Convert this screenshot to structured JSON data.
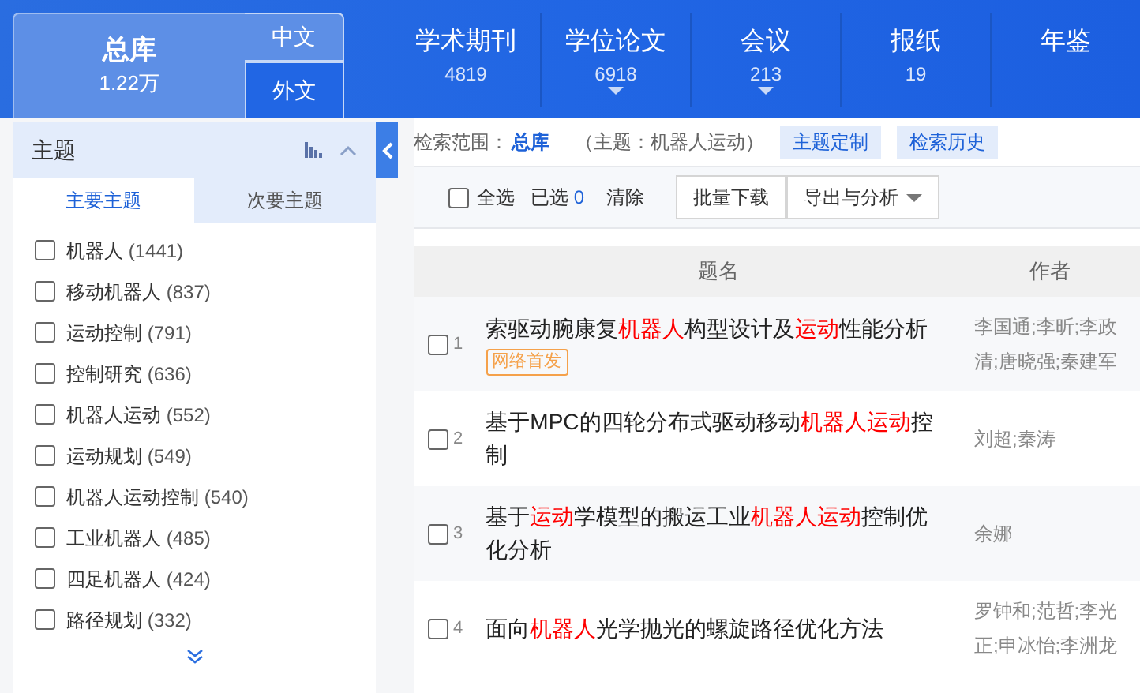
{
  "database_tabs": {
    "main": {
      "label": "总库",
      "count": "1.22万",
      "selected": true
    },
    "languages": [
      {
        "label": "中文",
        "selected": true
      },
      {
        "label": "外文",
        "selected": false
      }
    ],
    "categories": [
      {
        "label": "学术期刊",
        "count": "4819",
        "has_menu": false
      },
      {
        "label": "学位论文",
        "count": "6918",
        "has_menu": true
      },
      {
        "label": "会议",
        "count": "213",
        "has_menu": true
      },
      {
        "label": "报纸",
        "count": "19",
        "has_menu": false
      },
      {
        "label": "年鉴",
        "has_menu": false
      }
    ]
  },
  "facet_panel": {
    "title": "主题",
    "tabs": [
      {
        "label": "主要主题",
        "selected": true
      },
      {
        "label": "次要主题",
        "selected": false
      }
    ],
    "items": [
      {
        "label": "机器人",
        "count": "(1441)",
        "checked": false
      },
      {
        "label": "移动机器人",
        "count": "(837)",
        "checked": false
      },
      {
        "label": "运动控制",
        "count": "(791)",
        "checked": false
      },
      {
        "label": "控制研究",
        "count": "(636)",
        "checked": false
      },
      {
        "label": "机器人运动",
        "count": "(552)",
        "checked": false
      },
      {
        "label": "运动规划",
        "count": "(549)",
        "checked": false
      },
      {
        "label": "机器人运动控制",
        "count": "(540)",
        "checked": false
      },
      {
        "label": "工业机器人",
        "count": "(485)",
        "checked": false
      },
      {
        "label": "四足机器人",
        "count": "(424)",
        "checked": false
      },
      {
        "label": "路径规划",
        "count": "(332)",
        "checked": false
      }
    ]
  },
  "search_scope": {
    "label": "检索范围：",
    "scope": "总库",
    "query": "（主题：机器人运动）",
    "buttons": [
      "主题定制",
      "检索历史"
    ]
  },
  "toolbar": {
    "select_all": {
      "label": "全选",
      "checked": false
    },
    "selected_label": "已选",
    "selected_count": "0",
    "clear": "清除",
    "buttons": [
      {
        "label": "批量下载",
        "has_menu": false
      },
      {
        "label": "导出与分析",
        "has_menu": true
      }
    ]
  },
  "table": {
    "columns": [
      "题名",
      "作者"
    ],
    "rows": [
      {
        "number": "1",
        "checked": false,
        "title": [
          {
            "text": "索驱动腕康复",
            "highlight": false
          },
          {
            "text": "机器人",
            "highlight": true
          },
          {
            "text": "构型设计及",
            "highlight": false
          },
          {
            "text": "运动",
            "highlight": true
          },
          {
            "text": "性能分析",
            "highlight": false
          }
        ],
        "badge": "网络首发",
        "authors": "李国通;李昕;李政清;唐晓强;秦建军"
      },
      {
        "number": "2",
        "checked": false,
        "title": [
          {
            "text": "基于MPC的四轮分布式驱动移动",
            "highlight": false
          },
          {
            "text": "机器人运动",
            "highlight": true
          },
          {
            "text": "控制",
            "highlight": false
          }
        ],
        "authors": "刘超;秦涛"
      },
      {
        "number": "3",
        "checked": false,
        "title": [
          {
            "text": "基于",
            "highlight": false
          },
          {
            "text": "运动",
            "highlight": true
          },
          {
            "text": "学模型的搬运工业",
            "highlight": false
          },
          {
            "text": "机器人运动",
            "highlight": true
          },
          {
            "text": "控制优化分析",
            "highlight": false
          }
        ],
        "authors": "余娜"
      },
      {
        "number": "4",
        "checked": false,
        "title": [
          {
            "text": "面向",
            "highlight": false
          },
          {
            "text": "机器人",
            "highlight": true
          },
          {
            "text": "光学抛光的螺旋路径优化方法",
            "highlight": false
          }
        ],
        "authors": "罗钟和;范哲;李光正;申冰怡;李洲龙"
      }
    ]
  }
}
